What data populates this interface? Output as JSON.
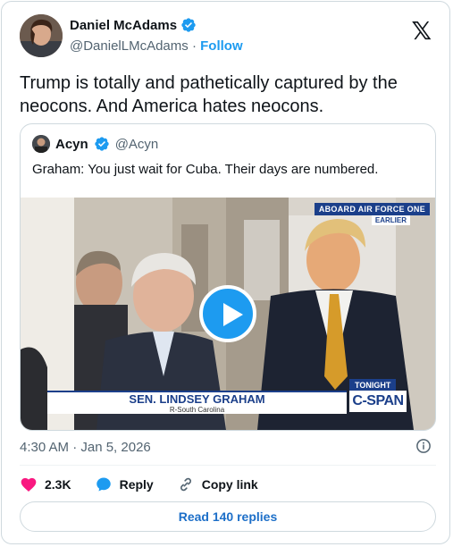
{
  "author": {
    "name": "Daniel McAdams",
    "handle": "@DanielLMcAdams",
    "separator": "·",
    "follow_label": "Follow"
  },
  "brand_icon": "x-logo",
  "tweet_text": "Trump is totally and pathetically captured by the neocons. And America hates neocons.",
  "quote": {
    "name": "Acyn",
    "handle": "@Acyn",
    "text": "Graham: You just wait for Cuba. Their days are numbered."
  },
  "video_overlay": {
    "top_banner": "ABOARD AIR FORCE ONE",
    "top_sub": "EARLIER",
    "lower_third_name": "SEN. LINDSEY GRAHAM",
    "lower_third_sub": "R-South Carolina",
    "tonight_label": "TONIGHT",
    "network_logo": "C-SPAN"
  },
  "timestamp": "4:30 AM · Jan 5, 2026",
  "actions": {
    "likes": "2.3K",
    "reply_label": "Reply",
    "copy_link_label": "Copy link"
  },
  "read_replies_label": "Read 140 replies",
  "colors": {
    "accent": "#1d9bf0",
    "like": "#f91880",
    "cspan_blue": "#1b3f8a"
  }
}
